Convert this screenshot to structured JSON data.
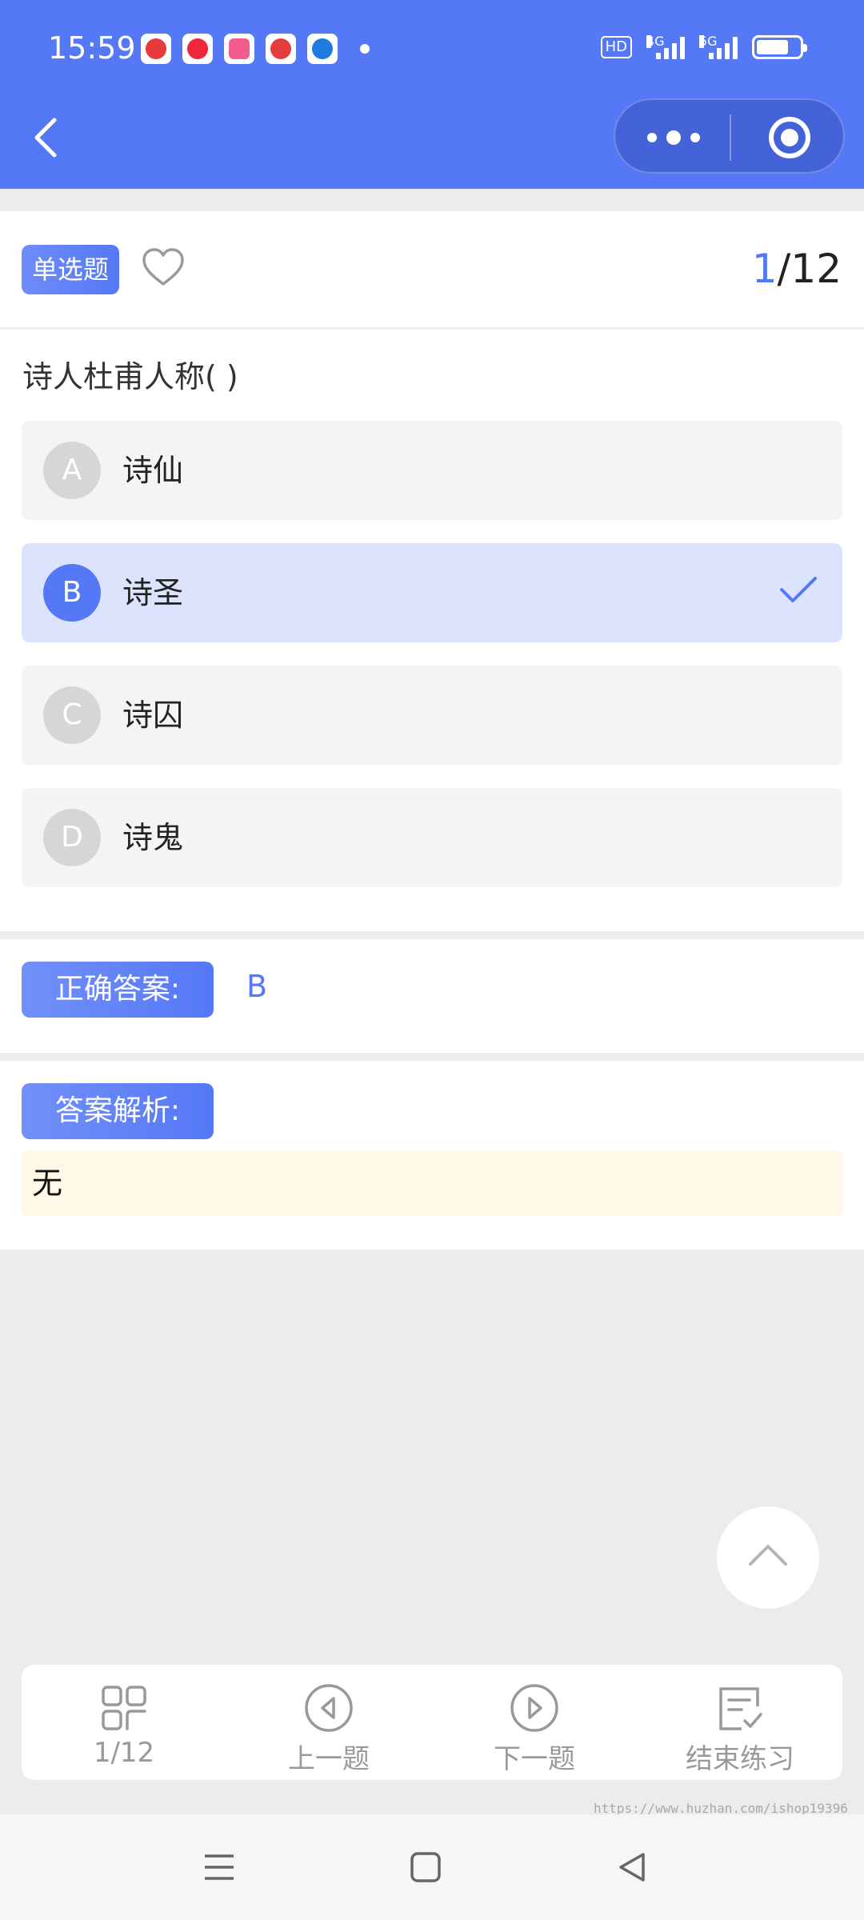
{
  "status_bar": {
    "time": "15:59",
    "apps": [
      {
        "icon": "mtr-app-icon",
        "color": "#e8393d"
      },
      {
        "icon": "video-app-icon",
        "color": "#f0273a"
      },
      {
        "icon": "bilibili-app-icon",
        "color": "#f25d8e"
      },
      {
        "icon": "mascot-app-icon",
        "color": "#e43d3d"
      },
      {
        "icon": "telecom-app-icon",
        "color": "#1f7be0"
      }
    ],
    "hd_badge": "HD",
    "network_label_1": "4G",
    "network_label_2": "5G",
    "battery_level": 0.75
  },
  "theme": {
    "primary": "#5478f6",
    "light_primary": "#dce4fd",
    "background": "#ececec"
  },
  "question": {
    "type_label": "单选题",
    "current": "1",
    "total": "/12",
    "text": "诗人杜甫人称( )",
    "options": [
      {
        "letter": "A",
        "text": "诗仙",
        "selected": false
      },
      {
        "letter": "B",
        "text": "诗圣",
        "selected": true
      },
      {
        "letter": "C",
        "text": "诗囚",
        "selected": false
      },
      {
        "letter": "D",
        "text": "诗鬼",
        "selected": false
      }
    ]
  },
  "answer": {
    "label": "正确答案:",
    "value": "B"
  },
  "explanation": {
    "label": "答案解析:",
    "text": "无"
  },
  "toolbar": {
    "items": [
      {
        "label": "1/12",
        "icon": "grid-icon"
      },
      {
        "label": "上一题",
        "icon": "prev-circle-icon"
      },
      {
        "label": "下一题",
        "icon": "next-circle-icon"
      },
      {
        "label": "结束练习",
        "icon": "finish-checklist-icon"
      }
    ]
  },
  "watermark": "https://www.huzhan.com/ishop19396"
}
